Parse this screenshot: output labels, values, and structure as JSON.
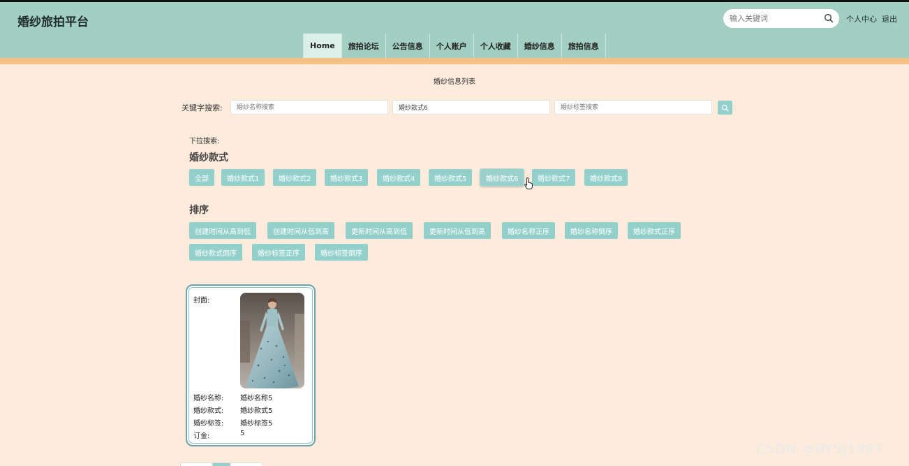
{
  "site": {
    "title": "婚纱旅拍平台"
  },
  "header": {
    "search_placeholder": "输入关键词",
    "links": {
      "personal_center": "个人中心",
      "logout": "退出"
    }
  },
  "nav": {
    "items": [
      {
        "label": "Home",
        "active": true
      },
      {
        "label": "旅拍论坛"
      },
      {
        "label": "公告信息"
      },
      {
        "label": "个人账户"
      },
      {
        "label": "个人收藏"
      },
      {
        "label": "婚纱信息"
      },
      {
        "label": "旅拍信息"
      }
    ]
  },
  "main": {
    "list_title": "婚纱信息列表",
    "keyword": {
      "label": "关键字搜索:",
      "name_placeholder": "婚纱名称搜索",
      "style_value": "婚纱款式6",
      "tag_placeholder": "婚纱标签搜索"
    },
    "dropdown_label": "下拉搜索:",
    "style_heading": "婚纱款式",
    "style_chips": [
      "全部",
      "婚纱款式1",
      "婚纱款式2",
      "婚纱款式3",
      "婚纱款式4",
      "婚纱款式5",
      "婚纱款式6",
      "婚纱款式7",
      "婚纱款式8"
    ],
    "selected_style_index": 6,
    "sort_heading": "排序",
    "sort_chips": [
      "创建时间从高到低",
      "创建时间从低到高",
      "更新时间从高到低",
      "更新时间从低到高",
      "婚纱名称正序",
      "婚纱名称倒序",
      "婚纱款式正序",
      "婚纱款式倒序",
      "婚纱标签正序",
      "婚纱标签倒序"
    ]
  },
  "card": {
    "cover_label": "封面:",
    "name_label": "婚纱名称:",
    "name_value": "婚纱名称5",
    "style_label": "婚纱款式:",
    "style_value": "婚纱款式5",
    "tag_label": "婚纱标签:",
    "tag_value": "婚纱标签5",
    "deposit_label": "订金:",
    "deposit_value": "5"
  },
  "watermark": "CSDN @BYSJ1987",
  "colors": {
    "header": "#a3cfc3",
    "accent_bar": "#f6c085",
    "chip": "#93d0cc",
    "page_bg": "#fdebdc"
  }
}
